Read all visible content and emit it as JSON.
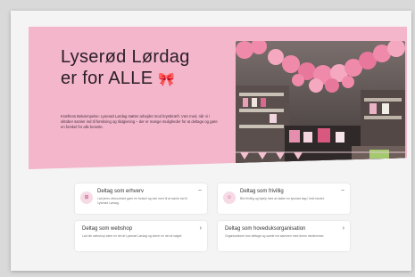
{
  "hero": {
    "title_line1": "Lyserød Lørdag",
    "title_line2": "er for ALLE",
    "bow": "🎀",
    "body": "Kræftens Bekæmpelse: Lyserød Lørdag støtter arbejdet mod brystkræft. Vær med, når vi i oktober samler ind til forskning og rådgivning – der er mange muligheder for at deltage og gøre en forskel for alle berørte."
  },
  "cards": [
    {
      "title": "Deltag som erhverv",
      "icon": "building-icon",
      "icon_glyph": "⊞",
      "text": "Lad jeres virksomhed gøre en forskel og vær med til at samle ind til Lyserød Lørdag.",
      "toggle": "−"
    },
    {
      "title": "Deltag som frivillig",
      "icon": "person-icon",
      "icon_glyph": "☺",
      "text": "Bliv frivillig og hjælp med at skabe en lyserød dag i hele landet.",
      "toggle": "−"
    },
    {
      "title": "Deltag som webshop",
      "text": "Lad din webshop være en del af Lyserød Lørdag og donér en del af salget.",
      "toggle": "›"
    },
    {
      "title": "Deltag som hoveduksorganisation",
      "text": "Organisationer kan deltage og samle ind sammen med deres medlemmer.",
      "toggle": "›"
    }
  ],
  "colors": {
    "hero_bg": "#f3b6cb",
    "accent": "#c0194a",
    "page_bg": "#f4f4f4"
  }
}
